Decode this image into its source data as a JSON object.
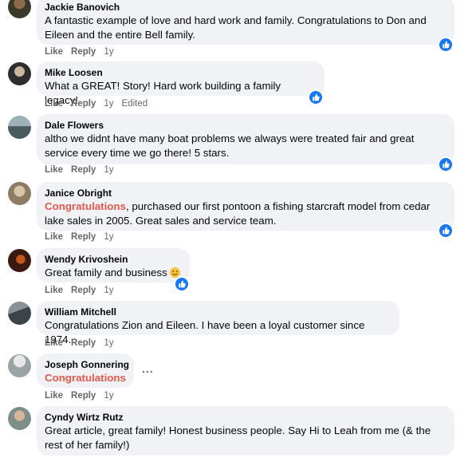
{
  "comments": [
    {
      "author": "Jackie Banovich",
      "text": "A fantastic example of love and hard work and family. Congratulations to Don and Eileen and the entire Bell family.",
      "actions": {
        "like": "Like",
        "reply": "Reply",
        "time": "1y"
      },
      "reaction": "like-icon"
    },
    {
      "author": "Mike Loosen",
      "text": "What a GREAT! Story! Hard work building a family legacy!",
      "actions": {
        "like": "Like",
        "reply": "Reply",
        "time": "1y",
        "edited": "Edited"
      },
      "reaction": "like-icon"
    },
    {
      "author": "Dale Flowers",
      "text": "altho we didnt have many boat problems we always were treated fair and great service every time we go there! 5 stars.",
      "actions": {
        "like": "Like",
        "reply": "Reply",
        "time": "1y"
      },
      "reaction": "like-icon"
    },
    {
      "author": "Janice Obright",
      "mention": "Congratulations",
      "text": ", purchased our first pontoon a fishing starcraft model from cedar lake sales in 2005. Great sales and service team.",
      "actions": {
        "like": "Like",
        "reply": "Reply",
        "time": "1y"
      },
      "reaction": "like-icon"
    },
    {
      "author": "Wendy Krivoshein",
      "text": "Great family and business",
      "emoji": "smiling-face-emoji",
      "actions": {
        "like": "Like",
        "reply": "Reply",
        "time": "1y"
      },
      "reaction": "like-icon"
    },
    {
      "author": "William Mitchell",
      "text": "Congratulations Zion and Eileen. I have been a loyal customer since 1974.",
      "actions": {
        "like": "Like",
        "reply": "Reply",
        "time": "1y"
      }
    },
    {
      "author": "Joseph Gonnering",
      "mention": "Congratulations",
      "actions": {
        "like": "Like",
        "reply": "Reply",
        "time": "1y"
      },
      "more": "..."
    },
    {
      "author": "Cyndy Wirtz Rutz",
      "text": "Great article, great family! Honest business people. Say Hi to Leah from me (& the rest of her family!)"
    }
  ],
  "colors": {
    "bubble": "#f0f2f5",
    "like_blue": "#1877f2",
    "mention": "#e4584a",
    "meta_gray": "#65676b"
  }
}
